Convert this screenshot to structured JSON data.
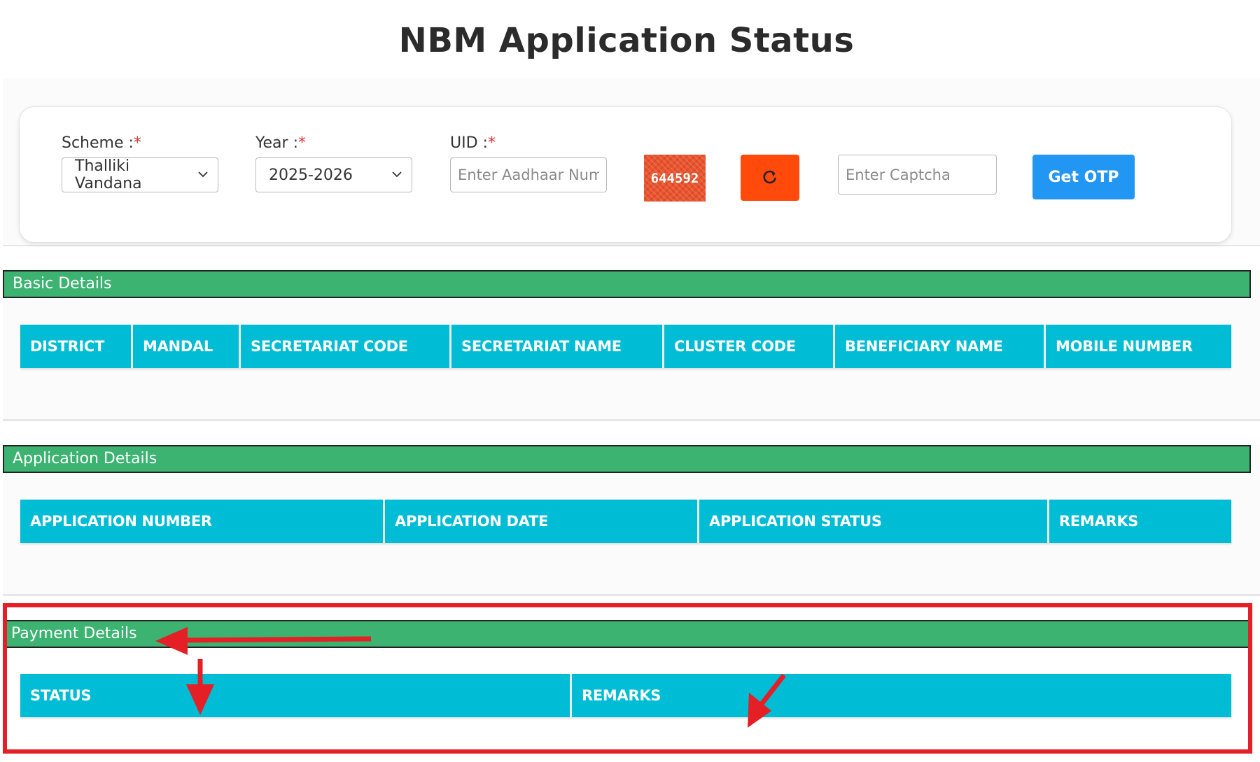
{
  "page": {
    "title": "NBM Application Status"
  },
  "form": {
    "scheme": {
      "label": "Scheme :",
      "required_mark": "*",
      "value": "Thalliki Vandana"
    },
    "year": {
      "label": "Year :",
      "required_mark": "*",
      "value": "2025-2026"
    },
    "uid": {
      "label": "UID :",
      "required_mark": "*",
      "placeholder": "Enter Aadhaar Num"
    },
    "captcha_code": "644592",
    "captcha_input": {
      "placeholder": "Enter Captcha"
    },
    "get_otp_label": "Get OTP"
  },
  "sections": {
    "basic": {
      "title": "Basic Details",
      "columns": [
        "DISTRICT",
        "MANDAL",
        "SECRETARIAT CODE",
        "SECRETARIAT NAME",
        "CLUSTER CODE",
        "BENEFICIARY NAME",
        "MOBILE NUMBER"
      ]
    },
    "application": {
      "title": "Application Details",
      "columns": [
        "APPLICATION NUMBER",
        "APPLICATION DATE",
        "APPLICATION STATUS",
        "REMARKS"
      ]
    },
    "payment": {
      "title": "Payment Details",
      "columns": [
        "STATUS",
        "REMARKS"
      ]
    }
  },
  "colors": {
    "section_bar": "#3cb371",
    "table_header": "#00bcd4",
    "otp_button": "#2196f3",
    "refresh_button": "#ff4a0b",
    "annotation": "#e41f26"
  },
  "icons": {
    "refresh": "refresh-icon",
    "dropdown": "chevron-down-icon"
  }
}
